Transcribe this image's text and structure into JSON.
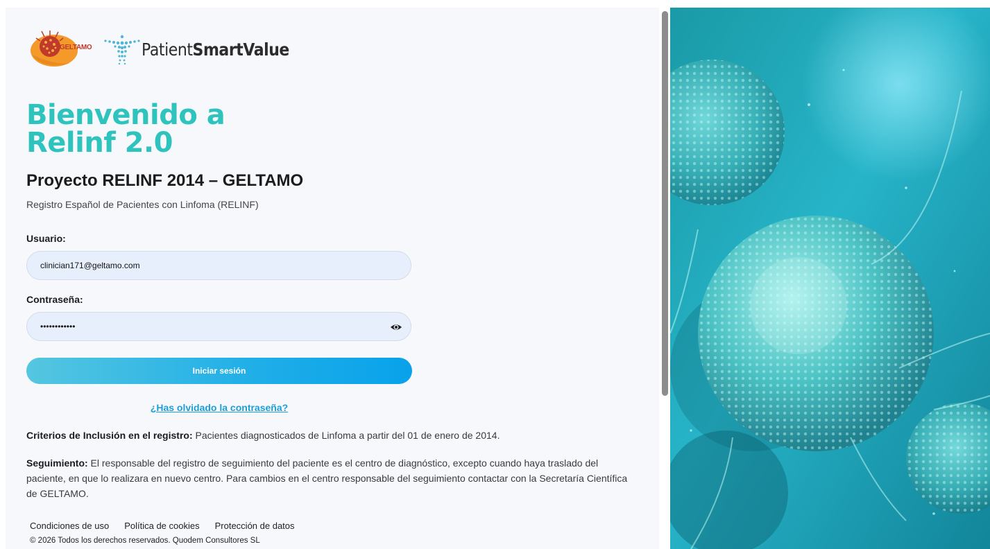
{
  "brand": {
    "geltamo_text": "GELTAMO",
    "psv_light": "Patient",
    "psv_bold": "SmartValue"
  },
  "welcome": {
    "line1": "Bienvenido a",
    "line2": "Relinf 2.0"
  },
  "project_title": "Proyecto RELINF 2014 – GELTAMO",
  "subtitle": "Registro Español de Pacientes con Linfoma (RELINF)",
  "form": {
    "user_label": "Usuario:",
    "user_value": "clinician171@geltamo.com",
    "password_label": "Contraseña:",
    "password_value": "clinician171",
    "login_label": "Iniciar sesión",
    "forgot_label": "¿Has olvidado la contraseña?"
  },
  "info": {
    "criteria_label": "Criterios de Inclusión en el registro:",
    "criteria_text": " Pacientes diagnosticados de Linfoma a partir del 01 de enero de 2014.",
    "follow_label": "Seguimiento:",
    "follow_text": " El responsable del registro de seguimiento del paciente es el centro de diagnóstico, excepto cuando haya traslado del paciente, en que lo realizara en nuevo centro. Para cambios en el centro responsable del seguimiento contactar con la Secretaría Científica de GELTAMO."
  },
  "footer": {
    "links": [
      "Condiciones de uso",
      "Política de cookies",
      "Protección de datos"
    ],
    "copyright": "© 2026 Todos los derechos reservados. Quodem Consultores SL"
  },
  "colors": {
    "accent_teal": "#2ec4bd",
    "link_blue": "#1b9fd6",
    "button_gradient_start": "#55c6e0",
    "button_gradient_end": "#08a2ea"
  },
  "icons": {
    "password_toggle": "eye-icon",
    "geltamo_logo": "geltamo-logo",
    "psv_logo": "patientsmartvalue-logo"
  }
}
